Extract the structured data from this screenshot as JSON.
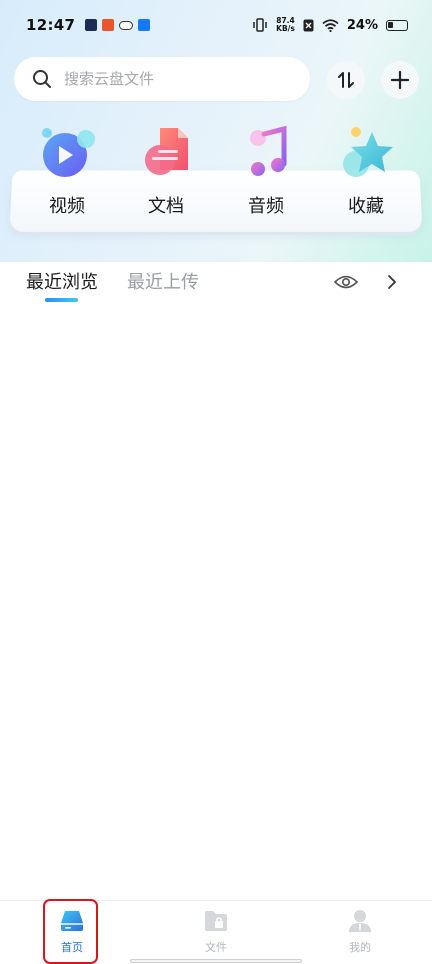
{
  "status_bar": {
    "time": "12:47",
    "net_speed_value": "87.4",
    "net_speed_unit": "KB/s",
    "battery": "24%"
  },
  "search": {
    "placeholder": "搜索云盘文件"
  },
  "categories": [
    {
      "label": "视频",
      "icon": "video-icon"
    },
    {
      "label": "文档",
      "icon": "document-icon"
    },
    {
      "label": "音频",
      "icon": "music-icon"
    },
    {
      "label": "收藏",
      "icon": "star-icon"
    }
  ],
  "tabs": {
    "recent_view": "最近浏览",
    "recent_upload": "最近上传"
  },
  "bottom_nav": [
    {
      "label": "首页",
      "icon": "home-drive-icon",
      "active": true
    },
    {
      "label": "文件",
      "icon": "folder-lock-icon",
      "active": false
    },
    {
      "label": "我的",
      "icon": "profile-icon",
      "active": false
    }
  ],
  "colors": {
    "accent": "#2a6fe0",
    "highlight": "#d8161e"
  }
}
